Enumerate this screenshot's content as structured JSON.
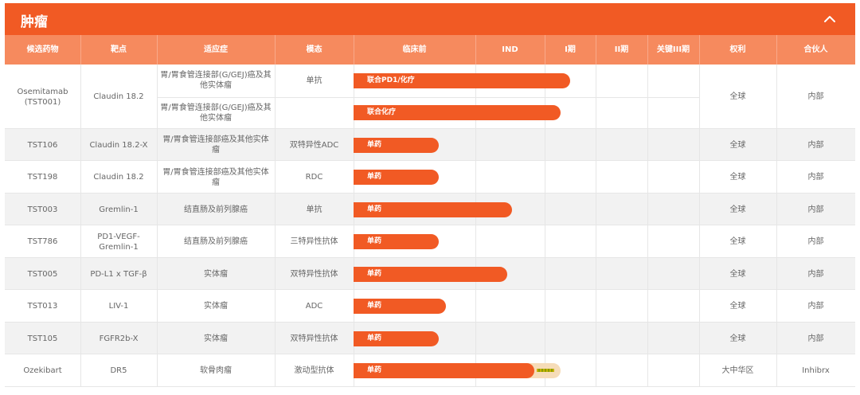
{
  "section": {
    "title": "肿瘤"
  },
  "columns": [
    "候选药物",
    "靶点",
    "适应症",
    "模态",
    "临床前",
    "IND",
    "I期",
    "II期",
    "关键III期",
    "权利",
    "合伙人"
  ],
  "rows": [
    {
      "candidate": "Osemitamab (TST001)",
      "target": "Claudin 18.2",
      "rights": "全球",
      "partner": "内部",
      "subrows": [
        {
          "indication": "胃/胃食管连接部(G/GEJ)癌及其他实体瘤",
          "modality": "单抗",
          "bar_label": "联合PD1/化疗",
          "progress": 0.626
        },
        {
          "indication": "胃/胃食管连接部(G/GEJ)癌及其他实体瘤",
          "modality": "",
          "bar_label": "联合化疗",
          "progress": 0.598
        }
      ]
    },
    {
      "candidate": "TST106",
      "target": "Claudin 18.2-X",
      "rights": "全球",
      "partner": "内部",
      "subrows": [
        {
          "indication": "胃/胃食管连接部癌及其他实体瘤",
          "modality": "双特异性ADC",
          "bar_label": "单药",
          "progress": 0.247
        }
      ]
    },
    {
      "candidate": "TST198",
      "target": "Claudin 18.2",
      "rights": "全球",
      "partner": "内部",
      "subrows": [
        {
          "indication": "胃/胃食管连接部癌及其他实体瘤",
          "modality": "RDC",
          "bar_label": "单药",
          "progress": 0.247
        }
      ]
    },
    {
      "candidate": "TST003",
      "target": "Gremlin-1",
      "rights": "全球",
      "partner": "内部",
      "subrows": [
        {
          "indication": "结直肠及前列腺癌",
          "modality": "单抗",
          "bar_label": "单药",
          "progress": 0.459
        }
      ]
    },
    {
      "candidate": "TST786",
      "target": "PD1-VEGF-Gremlin-1",
      "rights": "全球",
      "partner": "内部",
      "subrows": [
        {
          "indication": "结直肠及前列腺癌",
          "modality": "三特异性抗体",
          "bar_label": "单药",
          "progress": 0.247
        }
      ]
    },
    {
      "candidate": "TST005",
      "target": "PD-L1 x TGF-β",
      "rights": "全球",
      "partner": "内部",
      "subrows": [
        {
          "indication": "实体瘤",
          "modality": "双特异性抗体",
          "bar_label": "单药",
          "progress": 0.445
        }
      ]
    },
    {
      "candidate": "TST013",
      "target": "LIV-1",
      "rights": "全球",
      "partner": "内部",
      "subrows": [
        {
          "indication": "实体瘤",
          "modality": "ADC",
          "bar_label": "单药",
          "progress": 0.268
        }
      ]
    },
    {
      "candidate": "TST105",
      "target": "FGFR2b-X",
      "rights": "全球",
      "partner": "内部",
      "subrows": [
        {
          "indication": "实体瘤",
          "modality": "双特异性抗体",
          "bar_label": "单药",
          "progress": 0.247
        }
      ]
    },
    {
      "candidate": "Ozekibart",
      "target": "DR5",
      "rights": "大中华区",
      "partner": "Inhibrx",
      "subrows": [
        {
          "indication": "软骨肉瘤",
          "modality": "激动型抗体",
          "bar_label": "单药",
          "progress": 0.522,
          "track_progress": 0.6
        }
      ]
    }
  ],
  "colors": {
    "accent": "#f15a24",
    "header": "#f68a5e",
    "alt_row": "#f2f2f2",
    "track": "#f6dcb8"
  },
  "icons": {
    "collapse": "chevron-up-icon"
  }
}
